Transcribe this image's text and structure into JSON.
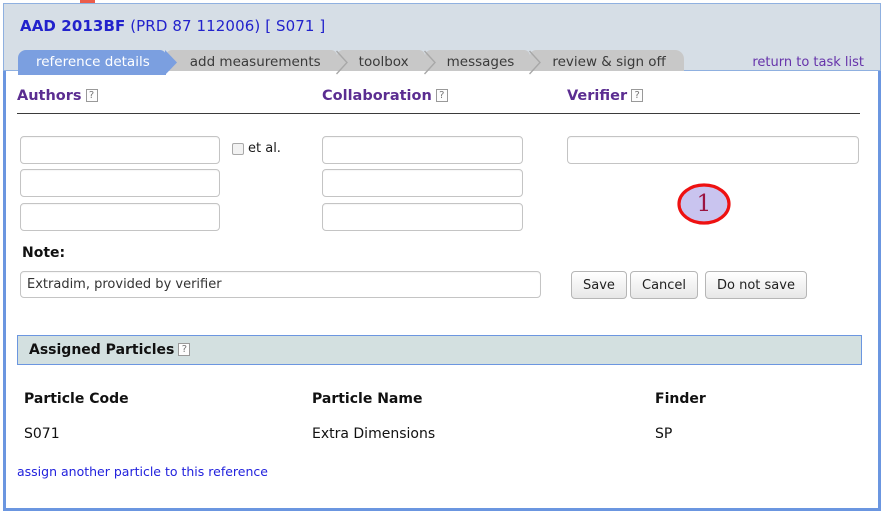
{
  "header": {
    "ref_code": "AAD 2013BF",
    "journal": "(PRD 87 112006)",
    "bracket": "[ S071 ]",
    "return_link": "return to task list"
  },
  "tabs": [
    {
      "label": "reference details",
      "active": true
    },
    {
      "label": "add measurements",
      "active": false
    },
    {
      "label": "toolbox",
      "active": false
    },
    {
      "label": "messages",
      "active": false
    },
    {
      "label": "review & sign off",
      "active": false
    }
  ],
  "form": {
    "headings": {
      "authors": "Authors",
      "collaboration": "Collaboration",
      "verifier": "Verifier",
      "help_glyph": "?"
    },
    "authors": [
      "",
      "",
      ""
    ],
    "authors_placeholder": "",
    "collaboration": [
      "",
      "",
      ""
    ],
    "collaboration_placeholder": "",
    "verifier": "",
    "verifier_placeholder": "",
    "et_al_label": "et al.",
    "et_al_checked": false,
    "note_label": "Note:",
    "note_value": "Extradim, provided by verifier",
    "note_placeholder": "",
    "buttons": {
      "save": "Save",
      "cancel": "Cancel",
      "do_not_save": "Do not save"
    }
  },
  "annotation": {
    "number": "1",
    "outline_color": "#ee1111",
    "fill_color": "#c9c4ef",
    "text_color": "#9b1440"
  },
  "assigned_particles": {
    "section_title": "Assigned Particles",
    "help_glyph": "?",
    "columns": [
      "Particle Code",
      "Particle Name",
      "Finder"
    ],
    "rows": [
      {
        "code": "S071",
        "name": "Extra Dimensions",
        "finder": "SP"
      }
    ],
    "assign_link": "assign another particle to this reference"
  },
  "colors": {
    "active_tab": "#7b9fe0",
    "inactive_tab": "#c8c8c8",
    "panel_border": "#6b96e0",
    "header_bg": "#d6dee6",
    "heading_purple": "#5b2d91",
    "title_blue": "#2222cc",
    "section_bar_bg": "#d3e0e0",
    "link_blue": "#2222dd",
    "return_link_purple": "#6633aa"
  }
}
